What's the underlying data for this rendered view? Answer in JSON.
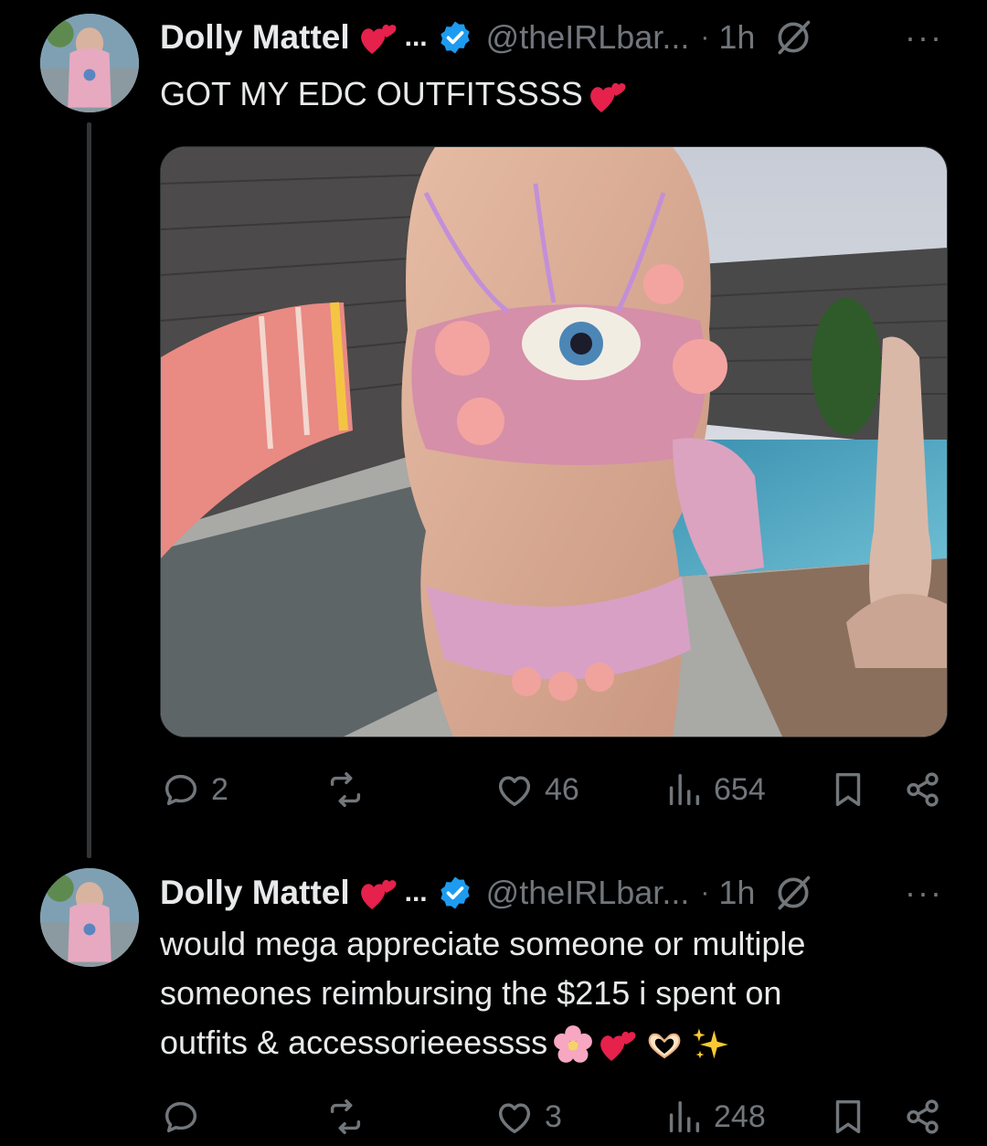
{
  "tweets": [
    {
      "author": "Dolly Mattel",
      "name_ellipsis": "...",
      "handle": "@theIRLbar...",
      "separator": "·",
      "time": "1h",
      "text": "GOT MY EDC OUTFITSSSS",
      "stats": {
        "replies": "2",
        "retweets": "",
        "likes": "46",
        "views": "654"
      }
    },
    {
      "author": "Dolly Mattel",
      "name_ellipsis": "...",
      "handle": "@theIRLbar...",
      "separator": "·",
      "time": "1h",
      "text_lines": [
        "would mega appreciate someone or multiple",
        "someones reimbursing the $215 i spent on",
        "outfits & accessorieeessss"
      ],
      "stats": {
        "replies": "",
        "retweets": "",
        "likes": "3",
        "views": "248"
      }
    }
  ],
  "more_label": "···",
  "icons": [
    "two-hearts-icon",
    "verified-badge-icon",
    "grok-icon",
    "more-icon",
    "reply-icon",
    "retweet-icon",
    "like-icon",
    "views-icon",
    "bookmark-icon",
    "share-icon",
    "cherry-blossom-icon",
    "heart-hands-icon",
    "sparkles-icon"
  ],
  "colors": {
    "background": "#000000",
    "text": "#e7e9ea",
    "secondary": "#71767b",
    "verified": "#1d9bf0",
    "heart": "#e5214c"
  }
}
